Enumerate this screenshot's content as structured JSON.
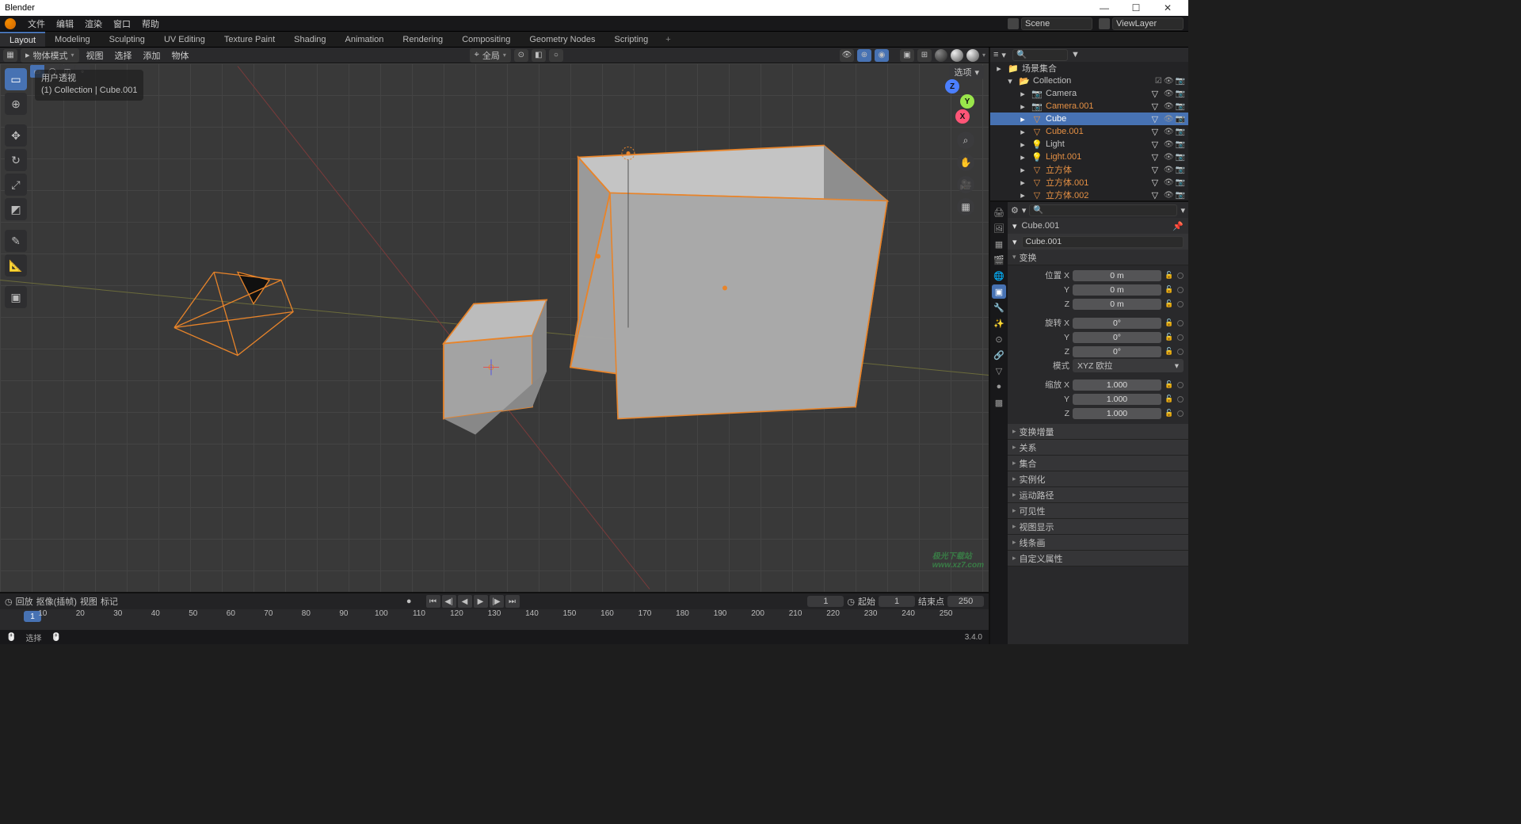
{
  "title": "Blender",
  "menubar": {
    "items": [
      "文件",
      "编辑",
      "渲染",
      "窗口",
      "帮助"
    ],
    "scene_label": "Scene",
    "viewlayer_label": "ViewLayer"
  },
  "workspaces": {
    "items": [
      "Layout",
      "Modeling",
      "Sculpting",
      "UV Editing",
      "Texture Paint",
      "Shading",
      "Animation",
      "Rendering",
      "Compositing",
      "Geometry Nodes",
      "Scripting"
    ],
    "active": 0,
    "plus": "+"
  },
  "vp_header": {
    "mode": "物体模式",
    "menus": [
      "视图",
      "选择",
      "添加",
      "物体"
    ],
    "orient": "全局",
    "options": "选项"
  },
  "overlay": {
    "line1": "用户透视",
    "line2": "(1) Collection | Cube.001"
  },
  "gizmo": {
    "x": "X",
    "y": "Y",
    "z": "Z"
  },
  "timeline": {
    "menus": [
      "回放",
      "抠像(插帧)",
      "视图",
      "标记"
    ],
    "start_label": "起始",
    "start": "1",
    "end_label": "结束点",
    "end": "250",
    "current": "1",
    "playhead": "1",
    "ticks": [
      "10",
      "20",
      "30",
      "40",
      "50",
      "60",
      "70",
      "80",
      "90",
      "100",
      "110",
      "120",
      "130",
      "140",
      "150",
      "160",
      "170",
      "180",
      "190",
      "200",
      "210",
      "220",
      "230",
      "240",
      "250"
    ]
  },
  "statusbar": {
    "select": "选择",
    "version": "3.4.0"
  },
  "outliner": {
    "root": "场景集合",
    "collection": "Collection",
    "items": [
      {
        "name": "Camera",
        "kind": "camera",
        "orange": false
      },
      {
        "name": "Camera.001",
        "kind": "camera",
        "orange": true
      },
      {
        "name": "Cube",
        "kind": "mesh",
        "orange": false,
        "selected": true
      },
      {
        "name": "Cube.001",
        "kind": "mesh",
        "orange": true
      },
      {
        "name": "Light",
        "kind": "light",
        "orange": false
      },
      {
        "name": "Light.001",
        "kind": "light",
        "orange": true
      },
      {
        "name": "立方体",
        "kind": "mesh",
        "orange": true
      },
      {
        "name": "立方体.001",
        "kind": "mesh",
        "orange": true
      },
      {
        "name": "立方体.002",
        "kind": "mesh",
        "orange": true
      }
    ]
  },
  "props": {
    "crumb": "Cube.001",
    "databox": "Cube.001",
    "transform_label": "变换",
    "loc_label": "位置 X",
    "locX": "0 m",
    "locY": "0 m",
    "locZ": "0 m",
    "rot_label": "旋转 X",
    "rotX": "0°",
    "rotY": "0°",
    "rotZ": "0°",
    "mode_label": "模式",
    "rot_mode": "XYZ 欧拉",
    "scale_label": "缩放 X",
    "sclX": "1.000",
    "sclY": "1.000",
    "sclZ": "1.000",
    "y_label": "Y",
    "z_label": "Z",
    "panels": [
      "变换增量",
      "关系",
      "集合",
      "实例化",
      "运动路径",
      "可见性",
      "视图显示",
      "线条画",
      "自定义属性"
    ]
  },
  "watermark": {
    "l1": "极光下载站",
    "l2": "www.xz7.com"
  }
}
